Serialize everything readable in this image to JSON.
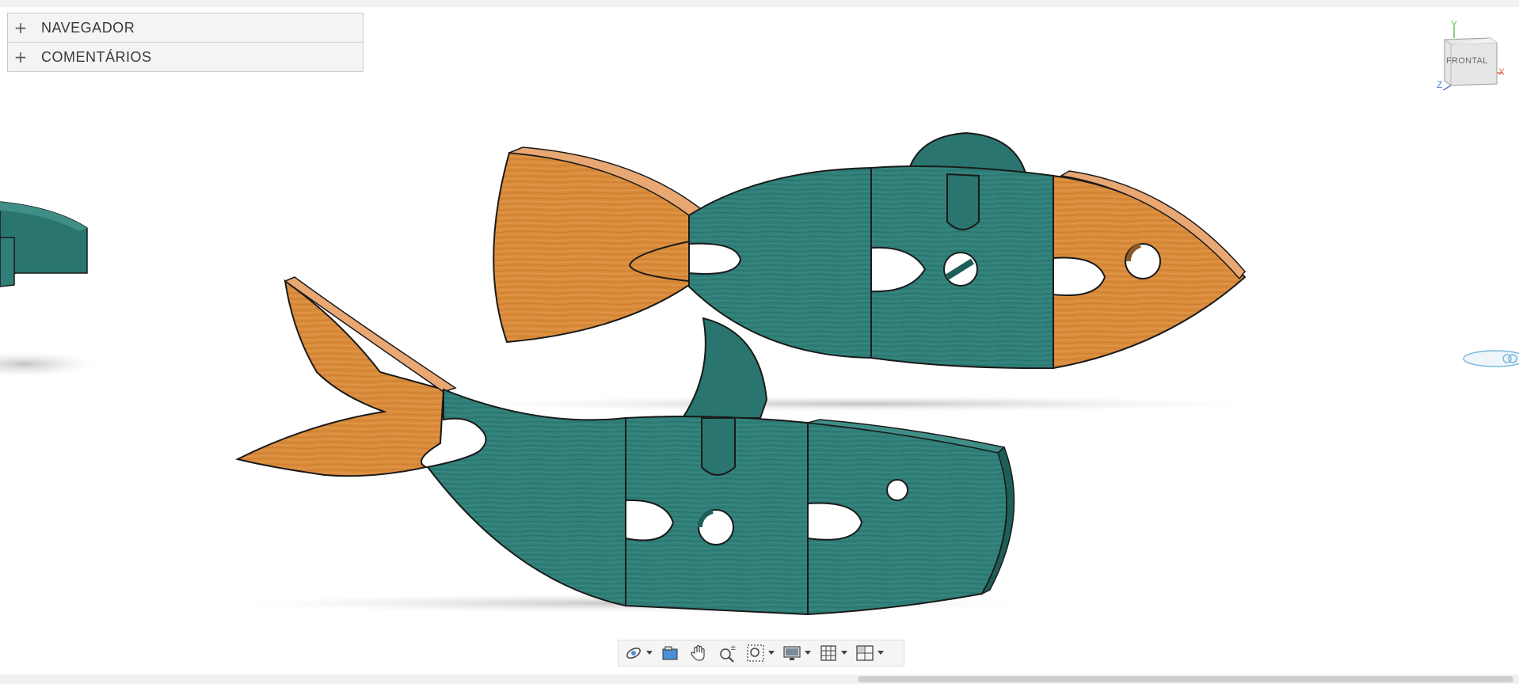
{
  "browser_panels": [
    {
      "label": "NAVEGADOR",
      "icon": "plus-icon"
    },
    {
      "label": "COMENTÁRIOS",
      "icon": "plus-icon"
    }
  ],
  "viewcube": {
    "face": "FRONTAL",
    "axis_x": "X",
    "axis_y": "Y",
    "axis_z": "Z"
  },
  "navbar": {
    "tools": [
      {
        "name": "orbit",
        "icon": "orbit-icon",
        "dropdown": true
      },
      {
        "name": "look-at",
        "icon": "look-at-icon",
        "dropdown": false
      },
      {
        "name": "pan",
        "icon": "pan-hand-icon",
        "dropdown": false
      },
      {
        "name": "zoom",
        "icon": "zoom-icon",
        "dropdown": false
      },
      {
        "name": "fit",
        "icon": "zoom-window-icon",
        "dropdown": true
      },
      {
        "name": "display-settings",
        "icon": "display-icon",
        "dropdown": true
      },
      {
        "name": "grid",
        "icon": "grid-icon",
        "dropdown": true
      },
      {
        "name": "viewports",
        "icon": "viewports-icon",
        "dropdown": true
      }
    ]
  },
  "colors": {
    "teal": "#2f7f78",
    "teal_dark": "#1f5e58",
    "orange": "#d98b3a",
    "orange_edge": "#e9a873",
    "outline": "#1a1a1a",
    "shadow": "#d4d4d4"
  }
}
